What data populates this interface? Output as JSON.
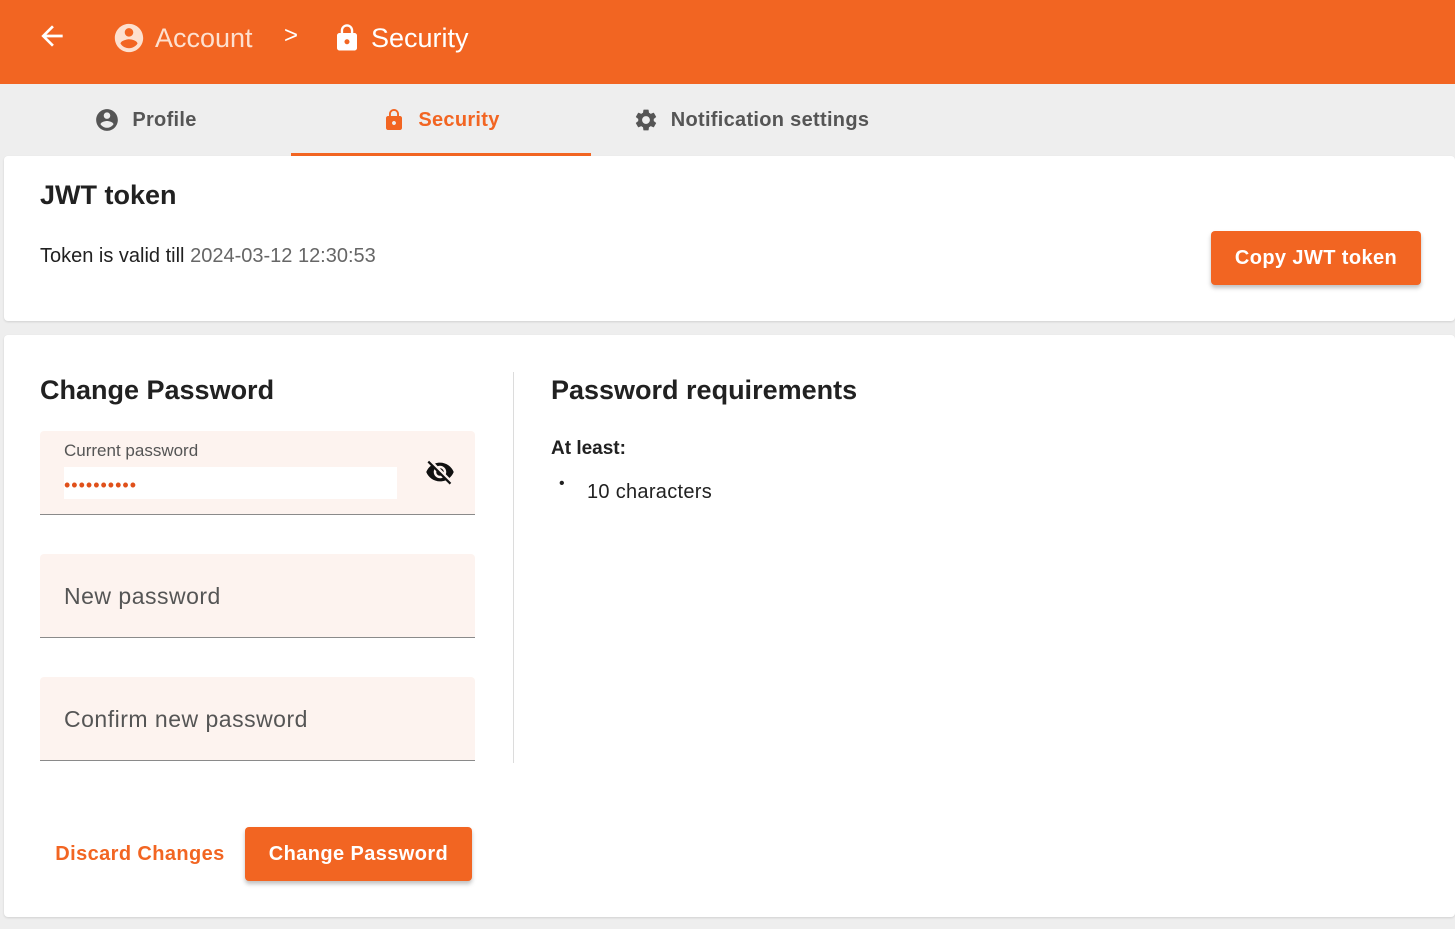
{
  "colors": {
    "accent": "#f26522",
    "tab_bg": "#eeeeee",
    "field_bg": "#fdf3ef"
  },
  "header": {
    "back_icon": "arrow-left-icon",
    "breadcrumb": [
      {
        "icon": "account-circle-icon",
        "label": "Account"
      },
      {
        "separator": ">"
      },
      {
        "icon": "lock-icon",
        "label": "Security"
      }
    ]
  },
  "tabs": [
    {
      "icon": "account-circle-icon",
      "label": "Profile",
      "active": false
    },
    {
      "icon": "lock-icon",
      "label": "Security",
      "active": true
    },
    {
      "icon": "gear-icon",
      "label": "Notification settings",
      "active": false
    }
  ],
  "jwt": {
    "title": "JWT token",
    "valid_prefix": "Token is valid till",
    "valid_until": "2024-03-12 12:30:53",
    "copy_label": "Copy JWT token"
  },
  "change_password": {
    "title": "Change Password",
    "current": {
      "label": "Current password",
      "value": "••••••••••",
      "toggle_icon": "eye-off-icon"
    },
    "new": {
      "placeholder": "New password"
    },
    "confirm": {
      "placeholder": "Confirm new password"
    },
    "discard_label": "Discard Changes",
    "submit_label": "Change Password"
  },
  "requirements": {
    "title": "Password requirements",
    "subtitle": "At least:",
    "items": [
      "10 characters"
    ],
    "bullet": "•"
  }
}
